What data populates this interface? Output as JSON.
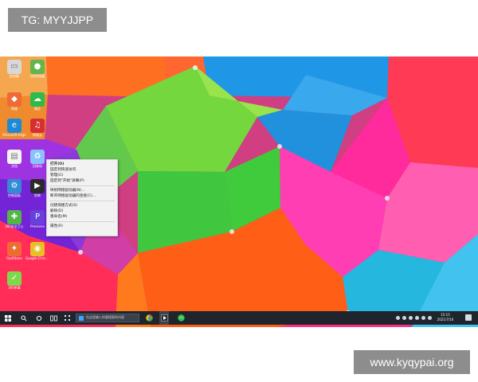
{
  "tags": {
    "top": "TG: MYYJJPP",
    "bottom": "www.kyqypai.org"
  },
  "desktop": {
    "icons": [
      {
        "label": "此电脑",
        "icon": "computer-icon",
        "color": "#d8d8d8"
      },
      {
        "label": "QQ浏览器",
        "icon": "browser-icon",
        "color": "#62b64a"
      },
      {
        "label": "网络",
        "icon": "network-icon",
        "color": "#f06a35"
      },
      {
        "label": "微信",
        "icon": "wechat-icon",
        "color": "#2ebb4a"
      },
      {
        "label": "Microsoft Edge",
        "icon": "edge-icon",
        "color": "#1e8ad6"
      },
      {
        "label": "网易云",
        "icon": "music-icon",
        "color": "#d72f2f"
      },
      {
        "label": "文档",
        "icon": "document-icon",
        "color": "#f4f4f4"
      },
      {
        "label": "回收站",
        "icon": "recycle-bin-icon",
        "color": "#89c3ff"
      },
      {
        "label": "控制面板",
        "icon": "control-panel-icon",
        "color": "#338bd6"
      },
      {
        "label": "剪映",
        "icon": "video-icon",
        "color": "#2a2a2a"
      },
      {
        "label": "360安全卫士",
        "icon": "security-icon",
        "color": "#53b748"
      },
      {
        "label": "Premiere",
        "icon": "premiere-icon",
        "color": "#6741d9"
      },
      {
        "label": "FastStone",
        "icon": "faststone-icon",
        "color": "#ef6b34"
      },
      {
        "label": "Google Chrome",
        "icon": "chrome-icon",
        "color": "#e7c025"
      },
      {
        "label": "360杀毒",
        "icon": "antivirus-icon",
        "color": "#7fd84b"
      }
    ]
  },
  "context_menu": {
    "items": [
      "打开(O)",
      "固定到快速访问",
      "管理(G)",
      "固定到\"开始\"屏幕(P)",
      "映射网络驱动器(N)...",
      "断开网络驱动器的连接(C)...",
      "创建快捷方式(S)",
      "删除(D)",
      "重命名(M)",
      "属性(R)"
    ]
  },
  "taskbar": {
    "search_text": "在这里输入你要搜索的内容",
    "time": "15:15",
    "date": "2021/7/16"
  }
}
